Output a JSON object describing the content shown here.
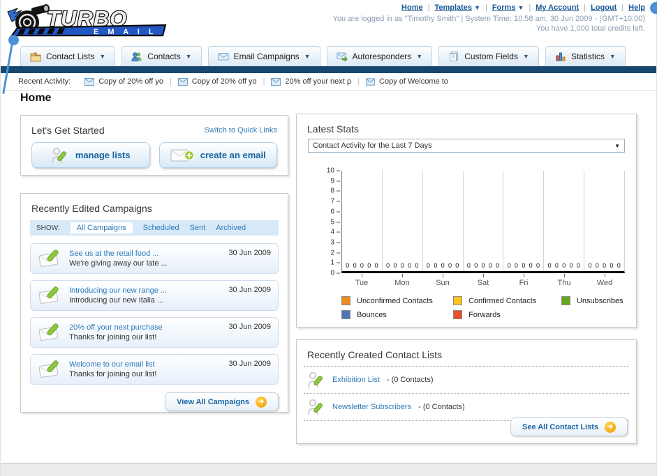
{
  "icons": {
    "arrow": "➜",
    "caret_down": "▼",
    "select_caret": "▼"
  },
  "header": {
    "logo_title": "TURBO",
    "logo_subtitle": "E M A I L",
    "nav_links": [
      {
        "label": "Home"
      },
      {
        "label": "Templates",
        "has_caret": true
      },
      {
        "label": "Forms",
        "has_caret": true
      },
      {
        "label": "My Account"
      },
      {
        "label": "Logout"
      },
      {
        "label": "Help"
      }
    ],
    "login_info": "You are logged in as \"Timothy Smith\" | System Time: 10:58 am, 30 Jun 2009 - (GMT+10:00)",
    "credits_info": "You have 1,000 total credits left."
  },
  "nav_tabs": [
    {
      "label": "Contact Lists"
    },
    {
      "label": "Contacts"
    },
    {
      "label": "Email Campaigns"
    },
    {
      "label": "Autoresponders"
    },
    {
      "label": "Custom Fields"
    },
    {
      "label": "Statistics"
    }
  ],
  "recent_activity": {
    "label": "Recent Activity:",
    "items": [
      "Copy of 20% off yo",
      "Copy of 20% off yo",
      "20% off your next p",
      "Copy of Welcome to"
    ]
  },
  "page_title": "Home",
  "get_started": {
    "title": "Let's Get Started",
    "switch_link": "Switch to Quick Links",
    "buttons": [
      {
        "label": "manage lists"
      },
      {
        "label": "create an email"
      }
    ]
  },
  "campaigns": {
    "title": "Recently Edited Campaigns",
    "filter_label": "SHOW:",
    "filters": [
      "All Campaigns",
      "Scheduled",
      "Sent",
      "Archived"
    ],
    "active_filter": "All Campaigns",
    "items": [
      {
        "title": "See us at the retail food ...",
        "subtitle": "We're giving away our late ...",
        "date": "30 Jun 2009"
      },
      {
        "title": "Introducing our new range ...",
        "subtitle": "Introducing our new Italia ...",
        "date": "30 Jun 2009"
      },
      {
        "title": "20% off your next purchase",
        "subtitle": "Thanks for joining our list!",
        "date": "30 Jun 2009"
      },
      {
        "title": "Welcome to our email list",
        "subtitle": "Thanks for joining our list!",
        "date": "30 Jun 2009"
      }
    ],
    "view_all_label": "View All Campaigns"
  },
  "latest_stats": {
    "title": "Latest Stats",
    "dropdown_value": "Contact Activity for the Last 7 Days"
  },
  "chart_data": {
    "type": "bar",
    "title": "Contact Activity for the Last 7 Days",
    "categories": [
      "Tue",
      "Mon",
      "Sun",
      "Sat",
      "Fri",
      "Thu",
      "Wed"
    ],
    "series": [
      {
        "name": "Unconfirmed Contacts",
        "color": "#f28b1e",
        "values": [
          0,
          0,
          0,
          0,
          0,
          0,
          0
        ]
      },
      {
        "name": "Confirmed Contacts",
        "color": "#fcc51c",
        "values": [
          0,
          0,
          0,
          0,
          0,
          0,
          0
        ]
      },
      {
        "name": "Unsubscribes",
        "color": "#68a41d",
        "values": [
          0,
          0,
          0,
          0,
          0,
          0,
          0
        ]
      },
      {
        "name": "Bounces",
        "color": "#5572b4",
        "values": [
          0,
          0,
          0,
          0,
          0,
          0,
          0
        ]
      },
      {
        "name": "Forwards",
        "color": "#e8502a",
        "values": [
          0,
          0,
          0,
          0,
          0,
          0,
          0
        ]
      }
    ],
    "ylim": [
      0,
      10
    ],
    "yticks": [
      0,
      1,
      2,
      3,
      4,
      5,
      6,
      7,
      8,
      9,
      10
    ],
    "grid": true,
    "legend_position": "bottom"
  },
  "contact_lists": {
    "title": "Recently Created Contact Lists",
    "items": [
      {
        "name": "Exhibition List",
        "detail": "- (0 Contacts)"
      },
      {
        "name": "Newsletter Subscribers",
        "detail": "- (0 Contacts)"
      }
    ],
    "see_all_label": "See All Contact Lists"
  }
}
